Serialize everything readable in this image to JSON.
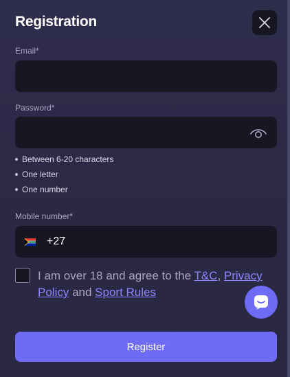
{
  "dialog": {
    "title": "Registration"
  },
  "email": {
    "label": "Email*",
    "value": "",
    "placeholder": ""
  },
  "password": {
    "label": "Password*",
    "value": "",
    "placeholder": "",
    "rules": [
      "Between 6-20 characters",
      "One letter",
      "One number"
    ]
  },
  "mobile": {
    "label": "Mobile number*",
    "country_code": "+27",
    "value": "",
    "placeholder": ""
  },
  "agreement": {
    "text_before": "I am over 18 and agree to the ",
    "tc_link": "T&C",
    "comma": ", ",
    "privacy_link": "Privacy Policy",
    "and": " and ",
    "sport_rules_link": "Sport Rules",
    "checked": false
  },
  "actions": {
    "register_label": "Register"
  },
  "icons": {
    "close": "close-icon",
    "eye": "eye-icon",
    "flag": "south-africa-flag-icon",
    "chat": "chat-icon"
  },
  "colors": {
    "accent": "#6e6bf5",
    "link": "#8a86ff",
    "background": "#2b2a45",
    "field": "#171723"
  }
}
